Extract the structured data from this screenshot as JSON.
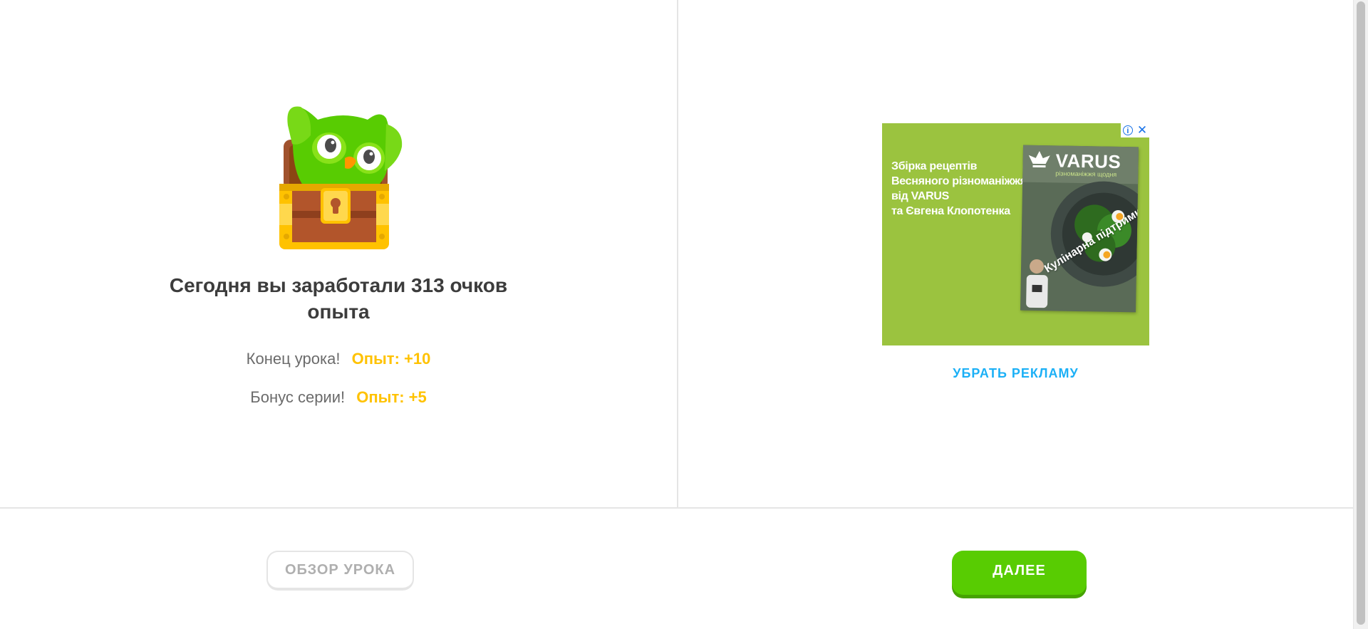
{
  "summary": {
    "headline": "Сегодня вы заработали 313 очков опыта",
    "rows": [
      {
        "label": "Конец урока!",
        "value": "Опыт: +10"
      },
      {
        "label": "Бонус серии!",
        "value": "Опыт: +5"
      }
    ]
  },
  "ad": {
    "info_icon": "i",
    "close_icon": "✕",
    "text_lines": [
      "Збірка рецептів",
      "Весняного різноманіжжя",
      "від VARUS",
      "та Євгена Клопотенка"
    ],
    "brand": "VARUS",
    "brand_sub": "різноманіжжя щодня",
    "caption": "Кулінарна підтримка",
    "background_color": "#9bc33f",
    "remove_ad_label": "УБРАТЬ РЕКЛАМУ"
  },
  "footer": {
    "review_label": "ОБЗОР УРОКА",
    "next_label": "ДАЛЕЕ",
    "next_color": "#58cc02"
  },
  "colors": {
    "xp_accent": "#ffc200",
    "link_blue": "#1cb0f6",
    "text_dark": "#3c3c3c"
  },
  "icons": {
    "mascot": "owl-treasure-chest-icon"
  }
}
